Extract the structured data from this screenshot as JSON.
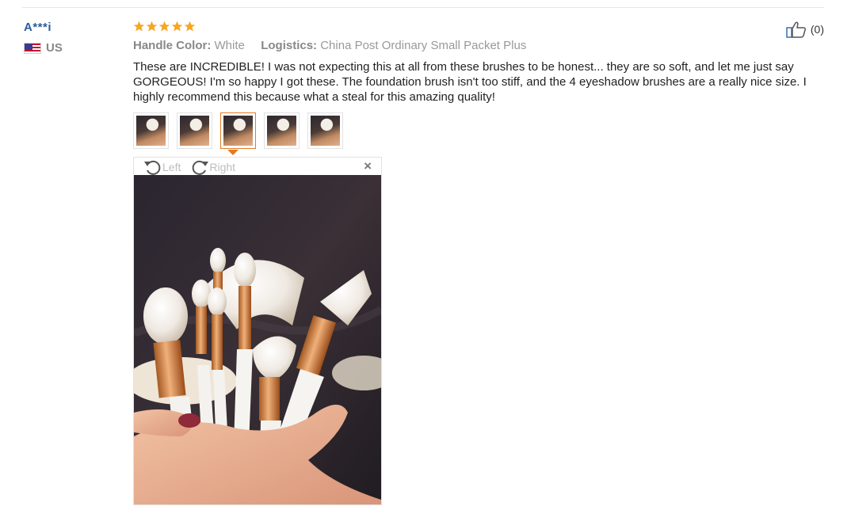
{
  "reviewer": {
    "name": "A***i",
    "country_code": "US",
    "flag_icon": "us-flag-icon"
  },
  "review": {
    "rating": 5,
    "rating_max": 5,
    "star_color": "#f5a623",
    "handle_color_label": "Handle Color:",
    "handle_color_value": "White",
    "logistics_label": "Logistics:",
    "logistics_value": "China Post Ordinary Small Packet Plus",
    "text": "These are INCREDIBLE! I was not expecting this at all from these brushes to be honest... they are so soft, and let me just say GORGEOUS! I'm so happy I got these. The foundation brush isn't too stiff, and the 4 eyeshadow brushes are a really nice size. I highly recommend this because what a steal for this amazing quality!",
    "like_icon": "thumbs-up-icon",
    "like_count": "(0)"
  },
  "gallery": {
    "thumbnail_count": 5,
    "selected_index": 2,
    "accent_color": "#e57a24"
  },
  "viewer": {
    "rotate_left_label": "Left",
    "rotate_right_label": "Right",
    "close_label": "×"
  }
}
